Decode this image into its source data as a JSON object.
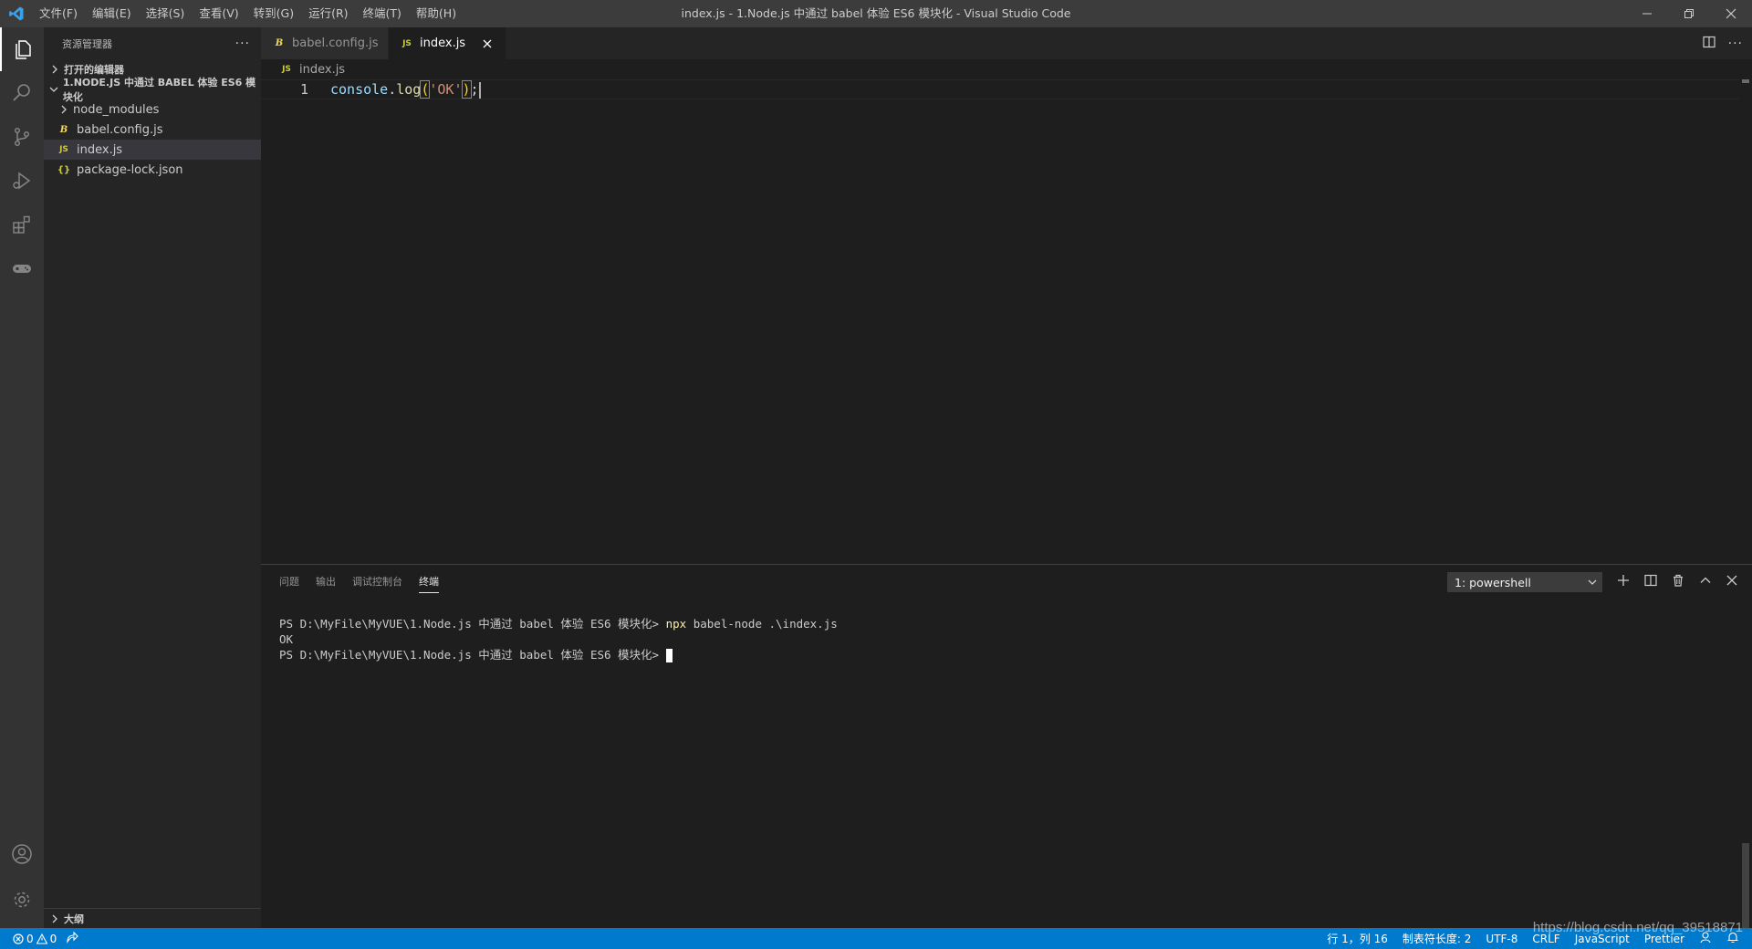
{
  "menu": [
    "文件(F)",
    "编辑(E)",
    "选择(S)",
    "查看(V)",
    "转到(G)",
    "运行(R)",
    "终端(T)",
    "帮助(H)"
  ],
  "window_title": "index.js - 1.Node.js 中通过 babel 体验 ES6 模块化 - Visual Studio Code",
  "sidebar": {
    "title": "资源管理器",
    "open_editors": "打开的编辑器",
    "folder": "1.NODE.JS 中通过 BABEL 体验 ES6 模块化",
    "items": [
      {
        "label": "node_modules",
        "badge": ""
      },
      {
        "label": "babel.config.js",
        "badge": "B"
      },
      {
        "label": "index.js",
        "badge": "JS"
      },
      {
        "label": "package-lock.json",
        "badge": "{}"
      }
    ],
    "outline": "大纲"
  },
  "tabs": [
    {
      "label": "babel.config.js",
      "badge": "B"
    },
    {
      "label": "index.js",
      "badge": "JS"
    }
  ],
  "breadcrumb": {
    "badge": "JS",
    "file": "index.js"
  },
  "editor": {
    "line_number": "1",
    "code": {
      "obj": "console",
      "dot": ".",
      "fn": "log",
      "open": "(",
      "str": "'OK'",
      "close": ")",
      "semi": ";"
    }
  },
  "panel": {
    "tabs": [
      "问题",
      "输出",
      "调试控制台",
      "终端"
    ],
    "terminal_select": "1: powershell",
    "lines": {
      "prompt1": "PS D:\\MyFile\\MyVUE\\1.Node.js 中通过 babel 体验 ES6 模块化> ",
      "cmd1": "npx",
      "args1": " babel-node .\\index.js",
      "out": "OK",
      "prompt2": "PS D:\\MyFile\\MyVUE\\1.Node.js 中通过 babel 体验 ES6 模块化> "
    }
  },
  "statusbar": {
    "errors": "0",
    "warnings": "0",
    "position": "行 1，列 16",
    "indent": "制表符长度: 2",
    "encoding": "UTF-8",
    "eol": "CRLF",
    "language": "JavaScript",
    "formatter": "Prettier"
  },
  "watermark": "https://blog.csdn.net/qq_39518871",
  "colors": {
    "accent": "#007acc",
    "js_badge": "#cbcb41",
    "babel_badge": "#f5da55",
    "json_badge": "#cbcb41"
  }
}
